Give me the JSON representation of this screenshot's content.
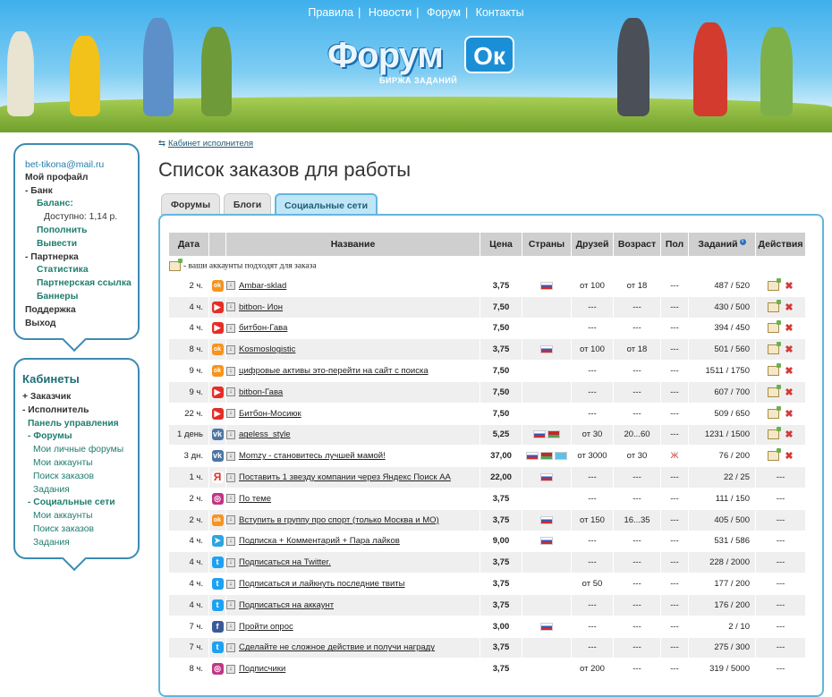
{
  "topnav": [
    "Правила",
    "Новости",
    "Форум",
    "Контакты"
  ],
  "logo": {
    "text": "Форум",
    "badge": "Ок",
    "subtitle": "БИРЖА ЗАДАНИЙ"
  },
  "user_menu": {
    "email": "bet-tikona@mail.ru",
    "items": [
      {
        "label": "Мой профайл",
        "style": "b"
      },
      {
        "label": "- Банк",
        "style": "b"
      },
      {
        "label": "Баланс:",
        "style": "g",
        "indent": 1
      },
      {
        "label": "Доступно: 1,14 р.",
        "style": "n",
        "indent": 1
      },
      {
        "label": "Пополнить",
        "style": "g",
        "indent": 1
      },
      {
        "label": "Вывести",
        "style": "g",
        "indent": 1
      },
      {
        "label": "- Партнерка",
        "style": "b"
      },
      {
        "label": "Статистика",
        "style": "g",
        "indent": 1
      },
      {
        "label": "Партнерская ссылка",
        "style": "g",
        "indent": 1
      },
      {
        "label": "Баннеры",
        "style": "g",
        "indent": 1
      },
      {
        "label": "Поддержка",
        "style": "b"
      },
      {
        "label": "Выход",
        "style": "b"
      }
    ]
  },
  "cabinets": {
    "title": "Кабинеты",
    "items": [
      {
        "label": "+ Заказчик",
        "style": "b",
        "indent": 0
      },
      {
        "label": "- Исполнитель",
        "style": "b",
        "indent": 0
      },
      {
        "label": "Панель управления",
        "style": "g",
        "indent": 1
      },
      {
        "label": "- Форумы",
        "style": "g",
        "indent": 1
      },
      {
        "label": "Мои личные форумы",
        "style": "nl",
        "indent": 2
      },
      {
        "label": "Мои аккаунты",
        "style": "nl",
        "indent": 2
      },
      {
        "label": "Поиск заказов",
        "style": "nl",
        "indent": 2
      },
      {
        "label": "Задания",
        "style": "nl",
        "indent": 2
      },
      {
        "label": "- Социальные сети",
        "style": "g",
        "indent": 1
      },
      {
        "label": "Мои аккаунты",
        "style": "nl",
        "indent": 2
      },
      {
        "label": "Поиск заказов",
        "style": "nl",
        "indent": 2
      },
      {
        "label": "Задания",
        "style": "nl",
        "indent": 2
      }
    ]
  },
  "breadcrumb": "Кабинет исполнителя",
  "page_title": "Список заказов для работы",
  "tabs": [
    "Форумы",
    "Блоги",
    "Социальные сети"
  ],
  "active_tab": 2,
  "table": {
    "headers": [
      "Дата",
      "",
      "Название",
      "Цена",
      "Страны",
      "Друзей",
      "Возраст",
      "Пол",
      "Заданий",
      "Действия"
    ],
    "note": "- ваши аккаунты подходят для заказа",
    "colors": {
      "ok": "#f7931e",
      "yt": "#e52d27",
      "vk": "#4c75a3",
      "ya": "#e52d27",
      "ig": "#c13584",
      "tg": "#2ca5e0",
      "tw": "#1da1f2",
      "fb": "#3b5998"
    },
    "rows": [
      {
        "date": "2 ч.",
        "icon": "ok",
        "name": "Ambar-sklad",
        "price": "3,75",
        "flags": [
          "ru"
        ],
        "friends": "от 100",
        "age": "от 18",
        "sex": "---",
        "tasks": "487 / 520",
        "actions": true
      },
      {
        "date": "4 ч.",
        "icon": "yt",
        "name": "bitbon- Ион",
        "price": "7,50",
        "flags": [],
        "friends": "---",
        "age": "---",
        "sex": "---",
        "tasks": "430 / 500",
        "actions": true
      },
      {
        "date": "4 ч.",
        "icon": "yt",
        "name": "битбон-Гава",
        "price": "7,50",
        "flags": [],
        "friends": "---",
        "age": "---",
        "sex": "---",
        "tasks": "394 / 450",
        "actions": true
      },
      {
        "date": "8 ч.",
        "icon": "ok",
        "name": "Kosmoslogistic",
        "price": "3,75",
        "flags": [
          "ru"
        ],
        "friends": "от 100",
        "age": "от 18",
        "sex": "---",
        "tasks": "501 / 560",
        "actions": true
      },
      {
        "date": "9 ч.",
        "icon": "ok",
        "name": "цифровые активы это-перейти на сайт с поиска",
        "price": "7,50",
        "flags": [],
        "friends": "---",
        "age": "---",
        "sex": "---",
        "tasks": "1511 / 1750",
        "actions": true
      },
      {
        "date": "9 ч.",
        "icon": "yt",
        "name": "bitbon-Гава",
        "price": "7,50",
        "flags": [],
        "friends": "---",
        "age": "---",
        "sex": "---",
        "tasks": "607 / 700",
        "actions": true
      },
      {
        "date": "22 ч.",
        "icon": "yt",
        "name": "Битбон-Мосиюк",
        "price": "7,50",
        "flags": [],
        "friends": "---",
        "age": "---",
        "sex": "---",
        "tasks": "509 / 650",
        "actions": true
      },
      {
        "date": "1 день",
        "icon": "vk",
        "name": "ageless_style",
        "price": "5,25",
        "flags": [
          "ru",
          "by"
        ],
        "friends": "от 30",
        "age": "20...60",
        "sex": "---",
        "tasks": "1231 / 1500",
        "actions": true
      },
      {
        "date": "3 дн.",
        "icon": "vk",
        "name": "Momzy - становитесь лучшей мамой!",
        "price": "37,00",
        "flags": [
          "ru",
          "by",
          "kz"
        ],
        "friends": "от 3000",
        "age": "от 30",
        "sex": "Ж",
        "tasks": "76 / 200",
        "actions": true
      },
      {
        "date": "1 ч.",
        "icon": "ya",
        "name": "Поставить 1 звезду компании через Яндекс Поиск АА",
        "price": "22,00",
        "flags": [
          "ru"
        ],
        "friends": "---",
        "age": "---",
        "sex": "---",
        "tasks": "22 / 25",
        "actions": false
      },
      {
        "date": "2 ч.",
        "icon": "ig",
        "name": "По теме",
        "price": "3,75",
        "flags": [],
        "friends": "---",
        "age": "---",
        "sex": "---",
        "tasks": "111 / 150",
        "actions": false
      },
      {
        "date": "2 ч.",
        "icon": "ok",
        "name": "Вступить в группу про спорт (только Москва и МО)",
        "price": "3,75",
        "flags": [
          "ru"
        ],
        "friends": "от 150",
        "age": "16...35",
        "sex": "---",
        "tasks": "405 / 500",
        "actions": false
      },
      {
        "date": "4 ч.",
        "icon": "tg",
        "name": "Подписка + Комментарий + Пара лайков",
        "price": "9,00",
        "flags": [
          "ru"
        ],
        "friends": "---",
        "age": "---",
        "sex": "---",
        "tasks": "531 / 586",
        "actions": false
      },
      {
        "date": "4 ч.",
        "icon": "tw",
        "name": "Подписаться на Twitter.",
        "price": "3,75",
        "flags": [],
        "friends": "---",
        "age": "---",
        "sex": "---",
        "tasks": "228 / 2000",
        "actions": false
      },
      {
        "date": "4 ч.",
        "icon": "tw",
        "name": "Подписаться и лайкнуть последние твиты",
        "price": "3,75",
        "flags": [],
        "friends": "от 50",
        "age": "---",
        "sex": "---",
        "tasks": "177 / 200",
        "actions": false
      },
      {
        "date": "4 ч.",
        "icon": "tw",
        "name": "Подписаться на аккаунт",
        "price": "3,75",
        "flags": [],
        "friends": "---",
        "age": "---",
        "sex": "---",
        "tasks": "176 / 200",
        "actions": false
      },
      {
        "date": "7 ч.",
        "icon": "fb",
        "name": "Пройти опрос",
        "price": "3,00",
        "flags": [
          "ru"
        ],
        "friends": "---",
        "age": "---",
        "sex": "---",
        "tasks": "2 / 10",
        "actions": false
      },
      {
        "date": "7 ч.",
        "icon": "tw",
        "name": "Сделайте не сложное действие и получи награду",
        "price": "3,75",
        "flags": [],
        "friends": "---",
        "age": "---",
        "sex": "---",
        "tasks": "275 / 300",
        "actions": false
      },
      {
        "date": "8 ч.",
        "icon": "ig",
        "name": "Подписчики",
        "price": "3,75",
        "flags": [],
        "friends": "от 200",
        "age": "---",
        "sex": "---",
        "tasks": "319 / 5000",
        "actions": false
      }
    ]
  }
}
